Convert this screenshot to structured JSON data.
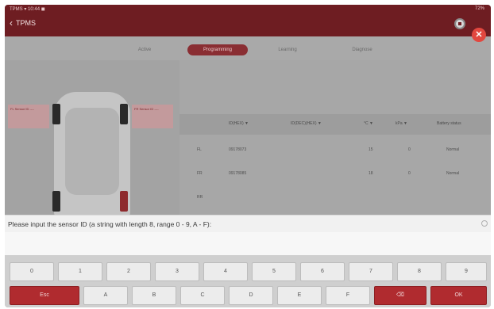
{
  "status_bar": {
    "left": "TPMS ▾ 10:44 ◼",
    "right": "72%"
  },
  "header": {
    "title": "TPMS"
  },
  "tabs": [
    {
      "label": "Active"
    },
    {
      "label": "Programming",
      "active": true
    },
    {
      "label": "Learning"
    },
    {
      "label": "Diagnose"
    }
  ],
  "wheel_tags": {
    "front_left": "FL\nSensor ID\n----",
    "front_right": "FR\nSensor ID\n----"
  },
  "table": {
    "headers": [
      "ID(HEX) ▼",
      "ID(DEC)(HEX) ▼",
      "°C ▼",
      "kPa ▼",
      "Battery status"
    ],
    "rows": [
      {
        "pos": "FL",
        "id": "09178073",
        "temp": "15",
        "pressure": "0",
        "battery": "Normal"
      },
      {
        "pos": "FR",
        "id": "09178085",
        "temp": "18",
        "pressure": "0",
        "battery": "Normal"
      },
      {
        "pos": "RR",
        "id": "",
        "temp": "",
        "pressure": "",
        "battery": ""
      }
    ]
  },
  "prompt": {
    "text": "Please input the sensor ID (a string with length 8, range 0 - 9, A - F):"
  },
  "keypad": {
    "digits": [
      "0",
      "1",
      "2",
      "3",
      "4",
      "5",
      "6",
      "7",
      "8",
      "9"
    ],
    "bottom": [
      {
        "label": "Esc",
        "red": true
      },
      {
        "label": "A"
      },
      {
        "label": "B"
      },
      {
        "label": "C"
      },
      {
        "label": "D"
      },
      {
        "label": "E"
      },
      {
        "label": "F"
      },
      {
        "label": "⌫",
        "red": true
      },
      {
        "label": "OK",
        "red": true
      }
    ]
  },
  "colors": {
    "primary": "#6e1d22",
    "accent": "#b02b2f",
    "close": "#e2473f"
  }
}
